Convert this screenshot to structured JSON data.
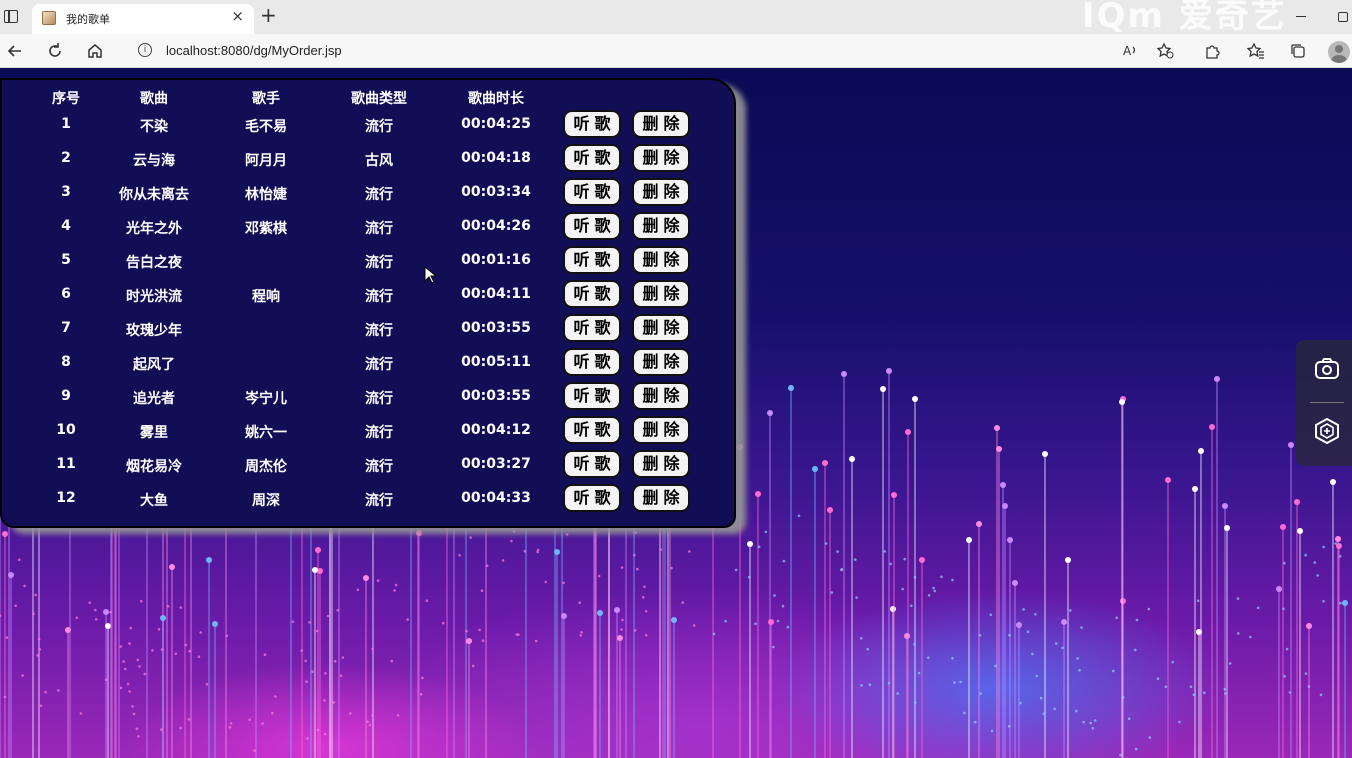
{
  "browser": {
    "tab_title": "我的歌单",
    "tab_close": "×",
    "new_tab": "+",
    "address": "localhost:8080/dg/MyOrder.jsp",
    "watermark": "IQm 爱奇艺",
    "icons": [
      "back-icon",
      "refresh-icon",
      "home-icon",
      "info-icon",
      "read-aloud-icon",
      "favorite-add-icon",
      "extensions-icon",
      "favorites-icon",
      "collections-icon",
      "profile-icon"
    ]
  },
  "table": {
    "headers": [
      "序号",
      "歌曲",
      "歌手",
      "歌曲类型",
      "歌曲时长"
    ],
    "play_label": "听歌",
    "delete_label": "删除",
    "rows": [
      {
        "no": "1",
        "song": "不染",
        "singer": "毛不易",
        "type": "流行",
        "duration": "00:04:25"
      },
      {
        "no": "2",
        "song": "云与海",
        "singer": "阿月月",
        "type": "古风",
        "duration": "00:04:18"
      },
      {
        "no": "3",
        "song": "你从未离去",
        "singer": "林怡婕",
        "type": "流行",
        "duration": "00:03:34"
      },
      {
        "no": "4",
        "song": "光年之外",
        "singer": "邓紫棋",
        "type": "流行",
        "duration": "00:04:26"
      },
      {
        "no": "5",
        "song": "告白之夜",
        "singer": "",
        "type": "流行",
        "duration": "00:01:16"
      },
      {
        "no": "6",
        "song": "时光洪流",
        "singer": "程响",
        "type": "流行",
        "duration": "00:04:11"
      },
      {
        "no": "7",
        "song": "玫瑰少年",
        "singer": "",
        "type": "流行",
        "duration": "00:03:55"
      },
      {
        "no": "8",
        "song": "起风了",
        "singer": "",
        "type": "流行",
        "duration": "00:05:11"
      },
      {
        "no": "9",
        "song": "追光者",
        "singer": "岑宁儿",
        "type": "流行",
        "duration": "00:03:55"
      },
      {
        "no": "10",
        "song": "雾里",
        "singer": "姚六一",
        "type": "流行",
        "duration": "00:04:12"
      },
      {
        "no": "11",
        "song": "烟花易冷",
        "singer": "周杰伦",
        "type": "流行",
        "duration": "00:03:27"
      },
      {
        "no": "12",
        "song": "大鱼",
        "singer": "周深",
        "type": "流行",
        "duration": "00:04:33"
      }
    ]
  },
  "side_dock": {
    "icons": [
      "camera-icon",
      "settings-hex-icon"
    ]
  },
  "colors": {
    "panel": "#110e56",
    "button_bg": "#f4f4f4",
    "text": "#ffffff"
  }
}
